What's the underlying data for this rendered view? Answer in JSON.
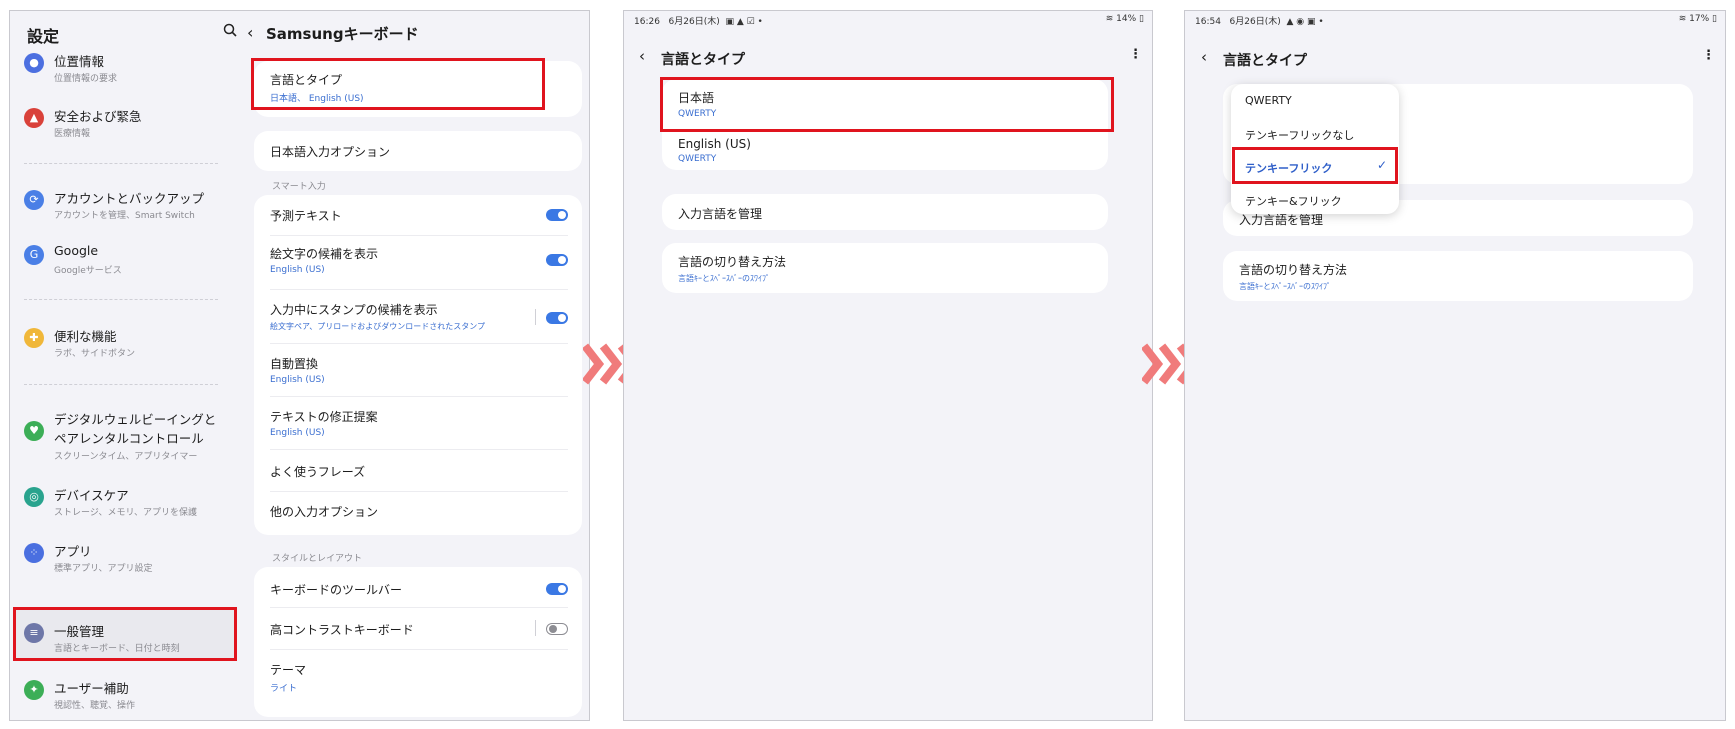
{
  "settings_panel": {
    "title": "設定",
    "items": [
      {
        "title": "位置情報",
        "sub": "位置情報の要求",
        "icon": "location-icon",
        "color": "#4c6fe0"
      },
      {
        "title": "安全および緊急",
        "sub": "医療情報",
        "icon": "emergency-icon",
        "color": "#d9413a"
      },
      {
        "title": "アカウントとバックアップ",
        "sub": "アカウントを管理、Smart Switch",
        "icon": "sync-icon",
        "color": "#4a7fe6"
      },
      {
        "title": "Google",
        "sub": "Googleサービス",
        "icon": "google-icon",
        "color": "#4a7fe6"
      },
      {
        "title": "便利な機能",
        "sub": "ラボ、サイドボタン",
        "icon": "gear-plus-icon",
        "color": "#f0b73a"
      },
      {
        "title": "デジタルウェルビーイングと",
        "title2": "ペアレンタルコントロール",
        "sub": "スクリーンタイム、アプリタイマー",
        "icon": "wellbeing-icon",
        "color": "#3cae57"
      },
      {
        "title": "デバイスケア",
        "sub": "ストレージ、メモリ、アプリを保護",
        "icon": "device-care-icon",
        "color": "#29a38e"
      },
      {
        "title": "アプリ",
        "sub": "標準アプリ、アプリ設定",
        "icon": "apps-icon",
        "color": "#4a6fe0"
      },
      {
        "title": "一般管理",
        "sub": "言語とキーボード、日付と時刻",
        "icon": "sliders-icon",
        "color": "#6e77a8"
      },
      {
        "title": "ユーザー補助",
        "sub": "視認性、聴覚、操作",
        "icon": "accessibility-icon",
        "color": "#3cae57"
      }
    ]
  },
  "keyboard_panel": {
    "title": "Samsungキーボード",
    "lang_type": {
      "title": "言語とタイプ",
      "sub": "日本語、 English (US)"
    },
    "jp_input": "日本語入力オプション",
    "section_smart": "スマート入力",
    "predictive": "予測テキスト",
    "emoji": {
      "title": "絵文字の候補を表示",
      "sub": "English (US)"
    },
    "stickers": {
      "title": "入力中にスタンプの候補を表示",
      "sub": "絵文字ペア、プリロードおよびダウンロードされたスタンプ"
    },
    "autoreplace": {
      "title": "自動置換",
      "sub": "English (US)"
    },
    "correction": {
      "title": "テキストの修正提案",
      "sub": "English (US)"
    },
    "phrases": "よく使うフレーズ",
    "other": "他の入力オプション",
    "section_style": "スタイルとレイアウト",
    "toolbar": "キーボードのツールバー",
    "contrast": "高コントラストキーボード",
    "theme": {
      "title": "テーマ",
      "sub": "ライト"
    },
    "toggles": {
      "predictive": true,
      "emoji": true,
      "stickers": true,
      "toolbar": true,
      "contrast": false
    }
  },
  "screen2": {
    "status_time": "16:26",
    "status_date": "6月26日(木)",
    "status_battery": "14%",
    "title": "言語とタイプ",
    "lang1": {
      "title": "日本語",
      "sub": "QWERTY"
    },
    "lang2": {
      "title": "English (US)",
      "sub": "QWERTY"
    },
    "manage": "入力言語を管理",
    "switch": {
      "title": "言語の切り替え方法",
      "sub": "言語ｷｰとｽﾍﾟｰｽﾊﾞｰのｽﾜｲﾌﾟ"
    }
  },
  "screen3": {
    "status_time": "16:54",
    "status_date": "6月26日(木)",
    "status_battery": "17%",
    "title": "言語とタイプ",
    "manage": "入力言語を管理",
    "switch": {
      "title": "言語の切り替え方法",
      "sub": "言語ｷｰとｽﾍﾟｰｽﾊﾞｰのｽﾜｲﾌﾟ"
    },
    "menu": [
      "QWERTY",
      "テンキーフリックなし",
      "テンキーフリック",
      "テンキー&フリック"
    ],
    "menu_selected": "テンキーフリック"
  },
  "colors": {
    "highlight": "#e0141e",
    "accent": "#3a78e4",
    "arrow": "#f07b7b"
  }
}
